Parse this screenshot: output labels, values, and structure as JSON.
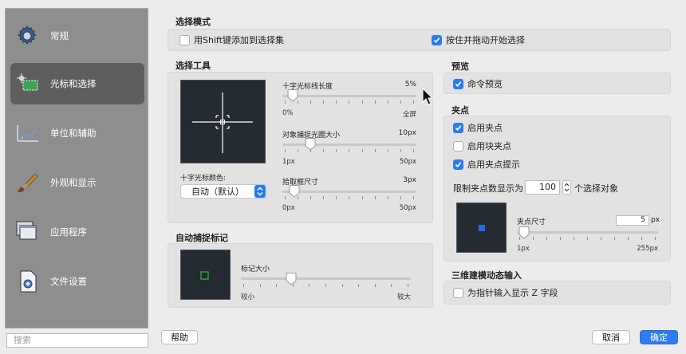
{
  "sidebar": {
    "items": [
      {
        "label": "常规",
        "icon": "gear-icon"
      },
      {
        "label": "光标和选择",
        "icon": "cursor-selection-icon"
      },
      {
        "label": "单位和辅助",
        "icon": "units-guides-icon"
      },
      {
        "label": "外观和显示",
        "icon": "paintbrush-icon"
      },
      {
        "label": "应用程序",
        "icon": "application-windows-icon"
      },
      {
        "label": "文件设置",
        "icon": "file-settings-icon"
      }
    ],
    "search_placeholder": "搜索"
  },
  "selection_mode": {
    "title": "选择模式",
    "shift_add": {
      "label": "用Shift键添加到选择集",
      "checked": false
    },
    "press_drag": {
      "label": "按住并拖动开始选择",
      "checked": true
    }
  },
  "selection_tools": {
    "title": "选择工具",
    "crosshair_size": {
      "label": "十字光标线长度",
      "value": "5%",
      "min": "0%",
      "max": "全屏",
      "fraction": 0.05
    },
    "osnap_aperture": {
      "label": "对象捕捉光圈大小",
      "value": "10px",
      "min": "1px",
      "max": "50px",
      "fraction": 0.18
    },
    "pickbox_size": {
      "label": "拾取框尺寸",
      "value": "3px",
      "min": "0px",
      "max": "50px",
      "fraction": 0.06
    },
    "crosshair_color_label": "十字光标颜色:",
    "crosshair_color_value": "自动（默认）"
  },
  "autosnap": {
    "title": "自动捕捉标记",
    "marker_size": {
      "label": "标记大小",
      "min": "较小",
      "max": "较大",
      "fraction": 0.27
    }
  },
  "preview": {
    "title": "预览",
    "command_preview": {
      "label": "命令预览",
      "checked": true
    }
  },
  "grips": {
    "title": "夹点",
    "enable_grips": {
      "label": "启用夹点",
      "checked": true
    },
    "enable_block_grips": {
      "label": "启用块夹点",
      "checked": false
    },
    "enable_grip_tips": {
      "label": "启用夹点提示",
      "checked": true
    },
    "limit_label": "限制夹点数显示为",
    "limit_value": "100",
    "limit_suffix": "个选择对象",
    "grip_size_label": "夹点尺寸",
    "grip_size_value": "5",
    "grip_size_unit": "px",
    "grip_size_min": "1px",
    "grip_size_max": "255px",
    "grip_size_fraction": 0.02
  },
  "dynamic_input_3d": {
    "title": "三维建模动态输入",
    "show_z": {
      "label": "为指针输入显示 Z 字段",
      "checked": false
    }
  },
  "footer": {
    "help": "帮助",
    "cancel": "取消",
    "ok": "确定"
  },
  "colors": {
    "accent": "#2b7bf0",
    "grip_blue": "#1f6fe0",
    "autosnap_green": "#2bc02b"
  }
}
